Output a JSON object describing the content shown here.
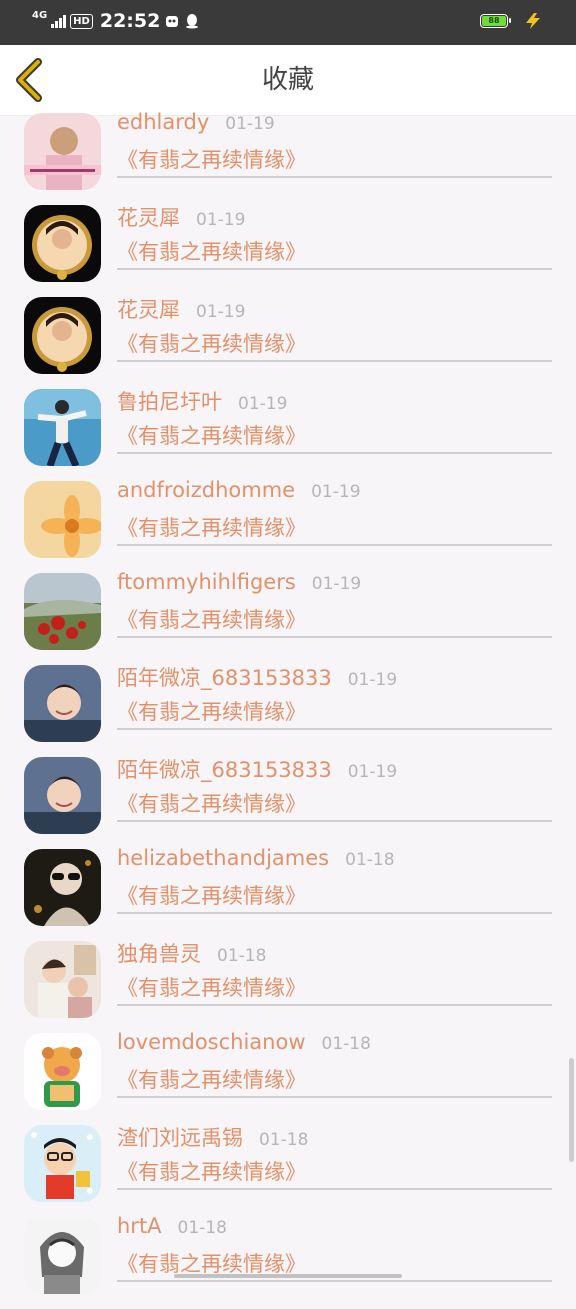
{
  "status_bar": {
    "network": "4G",
    "hd": "HD",
    "time": "22:52",
    "battery": "88"
  },
  "header": {
    "title": "收藏"
  },
  "items": [
    {
      "user": "edhlardy",
      "date": "01-19",
      "book": "《有翡之再续情缘》",
      "avatar": "pink-photo"
    },
    {
      "user": "花灵犀",
      "date": "01-19",
      "book": "《有翡之再续情缘》",
      "avatar": "framed-portrait"
    },
    {
      "user": "花灵犀",
      "date": "01-19",
      "book": "《有翡之再续情缘》",
      "avatar": "framed-portrait"
    },
    {
      "user": "鲁拍尼圩叶",
      "date": "01-19",
      "book": "《有翡之再续情缘》",
      "avatar": "dancer-blue"
    },
    {
      "user": "andfroizdhomme",
      "date": "01-19",
      "book": "《有翡之再续情缘》",
      "avatar": "yellow-flower"
    },
    {
      "user": "ftommyhihlfigers",
      "date": "01-19",
      "book": "《有翡之再续情缘》",
      "avatar": "red-flowers-landscape"
    },
    {
      "user": "陌年微凉_683153833",
      "date": "01-19",
      "book": "《有翡之再续情缘》",
      "avatar": "smiling-boy"
    },
    {
      "user": "陌年微凉_683153833",
      "date": "01-19",
      "book": "《有翡之再续情缘》",
      "avatar": "smiling-boy"
    },
    {
      "user": "helizabethandjames",
      "date": "01-18",
      "book": "《有翡之再续情缘》",
      "avatar": "sunglasses-person"
    },
    {
      "user": "独角兽灵",
      "date": "01-18",
      "book": "《有翡之再续情缘》",
      "avatar": "couple-photo"
    },
    {
      "user": "lovemdoschianow",
      "date": "01-18",
      "book": "《有翡之再续情缘》",
      "avatar": "cartoon-pig"
    },
    {
      "user": "渣们刘远禹锡",
      "date": "01-18",
      "book": "《有翡之再续情缘》",
      "avatar": "cartoon-kid"
    },
    {
      "user": "hrtA",
      "date": "01-18",
      "book": "《有翡之再续情缘》",
      "avatar": "anime-sketch"
    }
  ],
  "colors": {
    "accent": "#e3916a",
    "date": "#b6b6b6",
    "background": "#f7f5f7",
    "status_bar": "#3a3a3a",
    "back_arrow": "#e0b000"
  }
}
